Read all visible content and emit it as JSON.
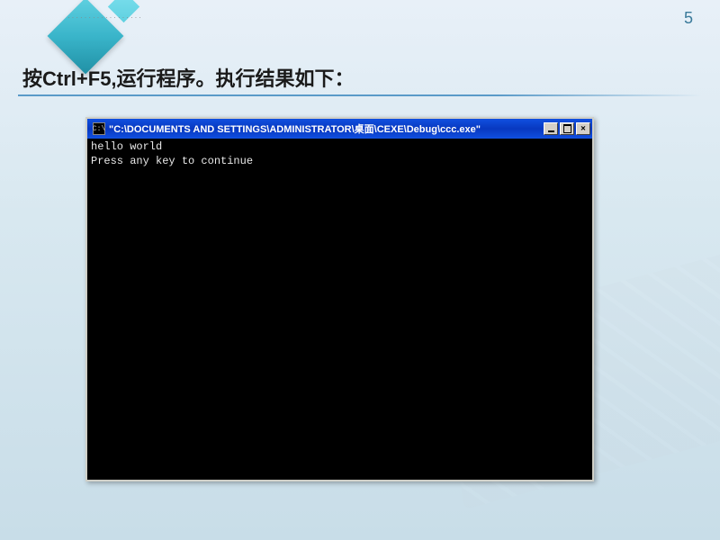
{
  "slide": {
    "page_number": "5",
    "title_prefix": "按",
    "title_key": "Ctrl+F5,",
    "title_suffix": "运行程序。执行结果如下：",
    "top_dots": "··················"
  },
  "console": {
    "icon_label": "C:\\",
    "title": "\"C:\\DOCUMENTS AND SETTINGS\\ADMINISTRATOR\\桌面\\CEXE\\Debug\\ccc.exe\"",
    "output_line1": "hello world",
    "output_line2": "Press any key to continue"
  }
}
